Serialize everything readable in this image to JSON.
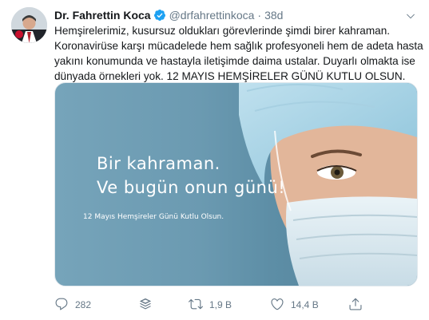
{
  "tweet": {
    "author_name": "Dr. Fahrettin Koca",
    "handle": "@drfahrettinkoca",
    "separator": "·",
    "time": "38d",
    "text_lines": [
      "Hemşirelerimiz, kusursuz oldukları görevlerinde şimdi birer kahraman.",
      "Koronavirüse karşı mücadelede hem sağlık profesyoneli hem de adeta hasta",
      "yakını konumunda ve hastayla iletişimde daima ustalar. Duyarlı olmakta ise",
      "dünyada örnekleri yok. 12 MAYIS HEMŞİRELER GÜNÜ KUTLU OLSUN."
    ]
  },
  "media": {
    "title_line1": "Bir kahraman.",
    "title_line2": "Ve bugün onun günü!",
    "subtitle": "12 Mayıs Hemşireler Günü Kutlu Olsun."
  },
  "actions": {
    "reply_count": "282",
    "retweet_count": "1,9 B",
    "like_count": "14,4 B"
  },
  "icons": {
    "verified": "verified-badge-icon",
    "caret": "chevron-down-icon",
    "reply": "reply-icon",
    "stack": "stack-icon",
    "retweet": "retweet-icon",
    "like": "heart-icon",
    "share": "share-icon"
  },
  "colors": {
    "accent": "#1da1f2",
    "text_primary": "#14171a",
    "text_secondary": "#657786"
  }
}
